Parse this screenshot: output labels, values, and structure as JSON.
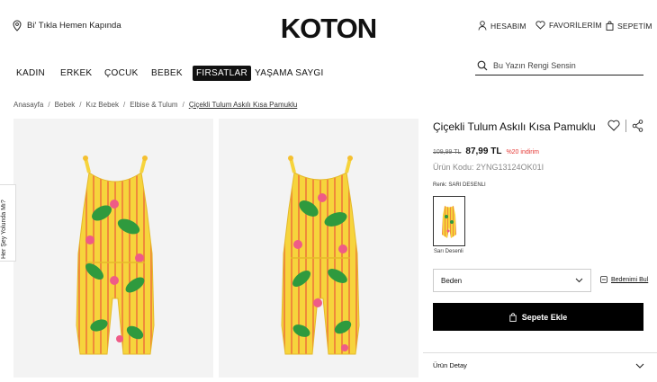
{
  "header": {
    "delivery_text": "Bi' Tıkla Hemen Kapında",
    "brand": "KOTON",
    "account_label": "HESABIM",
    "favorites_label": "FAVORİLERİM",
    "cart_label": "SEPETİM"
  },
  "nav": {
    "items": [
      {
        "label": "KADIN"
      },
      {
        "label": "ERKEK"
      },
      {
        "label": "ÇOCUK"
      },
      {
        "label": "BEBEK"
      },
      {
        "label": "FIRSATLAR"
      },
      {
        "label": "YAŞAMA SAYGI"
      }
    ],
    "active": "FIRSATLAR"
  },
  "search": {
    "placeholder": "Bu Yazın Rengi Sensin"
  },
  "breadcrumb": {
    "items": [
      "Anasayfa",
      "Bebek",
      "Kız Bebek",
      "Elbise & Tulum",
      "Çiçekli Tulum Askılı Kısa Pamuklu"
    ],
    "separator": "/"
  },
  "side_tab": {
    "label": "Her Şey Yolunda Mı?"
  },
  "product": {
    "title": "Çiçekli Tulum Askılı Kısa Pamuklu",
    "old_price": "109,99 TL",
    "new_price": "87,99 TL",
    "discount": "%20 indirim",
    "code": "Ürün Kodu: 2YNG13124OK01I",
    "color_label": "Renk: SARI DESENLI",
    "swatch_label": "Sarı Desenli",
    "size_label": "Beden",
    "size_guide": "Bedenimi Bul",
    "add_to_cart": "Sepete Ekle",
    "detail_label": "Ürün Detay"
  },
  "colors": {
    "accent": "#000000",
    "discount": "#e53935",
    "image_bg": "#f3f3f3",
    "garment_yellow": "#f6d43c",
    "leaf_green": "#2f9a3e",
    "flower_pink": "#ef5b87"
  }
}
